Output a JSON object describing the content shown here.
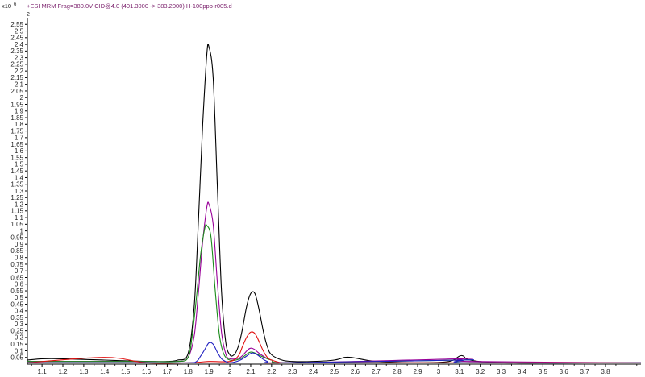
{
  "header": {
    "title": "+ESI MRM Frag=380.0V CID@4.0 (401.3000 -> 383.2000) H-100ppb-r005.d",
    "y_multiplier": "x10",
    "y_exponent": "6",
    "sub_marker": "2"
  },
  "chart_data": {
    "type": "line",
    "title": "+ESI MRM Frag=380.0V CID@4.0 (401.3000 -> 383.2000) H-100ppb-r005.d",
    "xlabel": "",
    "ylabel": "",
    "xlim": [
      1.03,
      3.97
    ],
    "ylim": [
      0,
      2.6
    ],
    "x_ticks": [
      "1.1",
      "1.2",
      "1.3",
      "1.4",
      "1.5",
      "1.6",
      "1.7",
      "1.8",
      "1.9",
      "2",
      "2.1",
      "2.2",
      "2.3",
      "2.4",
      "2.5",
      "2.6",
      "2.7",
      "2.8",
      "2.9",
      "3",
      "3.1",
      "3.2",
      "3.3",
      "3.4",
      "3.5",
      "3.6",
      "3.7",
      "3.8"
    ],
    "y_ticks": [
      "0.05",
      "0.1",
      "0.15",
      "0.2",
      "0.25",
      "0.3",
      "0.35",
      "0.4",
      "0.45",
      "0.5",
      "0.55",
      "0.6",
      "0.65",
      "0.7",
      "0.75",
      "0.8",
      "0.85",
      "0.9",
      "0.95",
      "1",
      "1.05",
      "1.1",
      "1.15",
      "1.2",
      "1.25",
      "1.3",
      "1.35",
      "1.4",
      "1.45",
      "1.5",
      "1.55",
      "1.6",
      "1.65",
      "1.7",
      "1.75",
      "1.8",
      "1.85",
      "1.9",
      "1.95",
      "2",
      "2.05",
      "2.1",
      "2.15",
      "2.2",
      "2.25",
      "2.3",
      "2.35",
      "2.4",
      "2.45",
      "2.5",
      "2.55"
    ],
    "grid": false,
    "legend": "none",
    "series": [
      {
        "color": "#000000",
        "x": [
          1.03,
          1.1,
          1.2,
          1.4,
          1.6,
          1.7,
          1.75,
          1.8,
          1.83,
          1.85,
          1.87,
          1.89,
          1.9,
          1.92,
          1.94,
          1.96,
          1.98,
          2.0,
          2.02,
          2.04,
          2.06,
          2.08,
          2.1,
          2.12,
          2.14,
          2.16,
          2.18,
          2.2,
          2.25,
          2.3,
          2.4,
          2.5,
          2.55,
          2.58,
          2.62,
          2.7,
          2.9,
          3.05,
          3.1,
          3.12,
          3.15,
          3.3,
          3.6,
          3.97
        ],
        "y": [
          0.03,
          0.04,
          0.04,
          0.03,
          0.02,
          0.02,
          0.03,
          0.08,
          0.45,
          1.1,
          1.8,
          2.33,
          2.38,
          2.15,
          1.35,
          0.55,
          0.17,
          0.07,
          0.07,
          0.13,
          0.26,
          0.43,
          0.53,
          0.53,
          0.41,
          0.25,
          0.13,
          0.07,
          0.03,
          0.02,
          0.02,
          0.03,
          0.05,
          0.05,
          0.04,
          0.02,
          0.01,
          0.02,
          0.06,
          0.06,
          0.03,
          0.01,
          0.01,
          0.01
        ]
      },
      {
        "color": "#990099",
        "x": [
          1.03,
          1.4,
          1.6,
          1.75,
          1.8,
          1.83,
          1.85,
          1.87,
          1.89,
          1.9,
          1.92,
          1.94,
          1.96,
          1.98,
          2.0,
          2.05,
          2.1,
          2.15,
          2.2,
          2.3,
          3.1,
          3.12,
          3.15,
          3.97
        ],
        "y": [
          0.02,
          0.02,
          0.02,
          0.02,
          0.05,
          0.22,
          0.55,
          0.92,
          1.18,
          1.2,
          1.05,
          0.62,
          0.24,
          0.08,
          0.04,
          0.05,
          0.12,
          0.07,
          0.03,
          0.01,
          0.04,
          0.04,
          0.02,
          0.01
        ]
      },
      {
        "color": "#1a8a1a",
        "x": [
          1.03,
          1.4,
          1.6,
          1.75,
          1.8,
          1.82,
          1.84,
          1.86,
          1.88,
          1.89,
          1.91,
          1.93,
          1.95,
          1.97,
          2.0,
          2.05,
          2.1,
          2.15,
          2.2,
          2.3,
          3.1,
          3.12,
          3.15,
          3.97
        ],
        "y": [
          0.02,
          0.02,
          0.02,
          0.02,
          0.05,
          0.22,
          0.5,
          0.82,
          1.02,
          1.04,
          0.95,
          0.55,
          0.22,
          0.08,
          0.03,
          0.04,
          0.09,
          0.06,
          0.03,
          0.01,
          0.03,
          0.03,
          0.01,
          0.01
        ]
      },
      {
        "color": "#e01010",
        "x": [
          1.03,
          1.4,
          1.6,
          1.8,
          1.9,
          2.0,
          2.04,
          2.06,
          2.08,
          2.1,
          2.12,
          2.14,
          2.16,
          2.18,
          2.2,
          2.25,
          2.3,
          3.97
        ],
        "y": [
          0.01,
          0.05,
          0.01,
          0.01,
          0.02,
          0.02,
          0.06,
          0.13,
          0.2,
          0.24,
          0.23,
          0.17,
          0.1,
          0.05,
          0.03,
          0.01,
          0.01,
          0.01
        ]
      },
      {
        "color": "#2020c0",
        "x": [
          1.03,
          1.6,
          1.8,
          1.84,
          1.86,
          1.88,
          1.9,
          1.92,
          1.94,
          1.96,
          1.98,
          2.0,
          2.05,
          2.1,
          2.12,
          2.14,
          2.18,
          2.25,
          3.1,
          3.12,
          3.14,
          3.97
        ],
        "y": [
          0.01,
          0.01,
          0.01,
          0.02,
          0.06,
          0.11,
          0.16,
          0.15,
          0.09,
          0.04,
          0.02,
          0.01,
          0.03,
          0.08,
          0.08,
          0.06,
          0.02,
          0.01,
          0.03,
          0.03,
          0.01,
          0.01
        ]
      }
    ]
  }
}
